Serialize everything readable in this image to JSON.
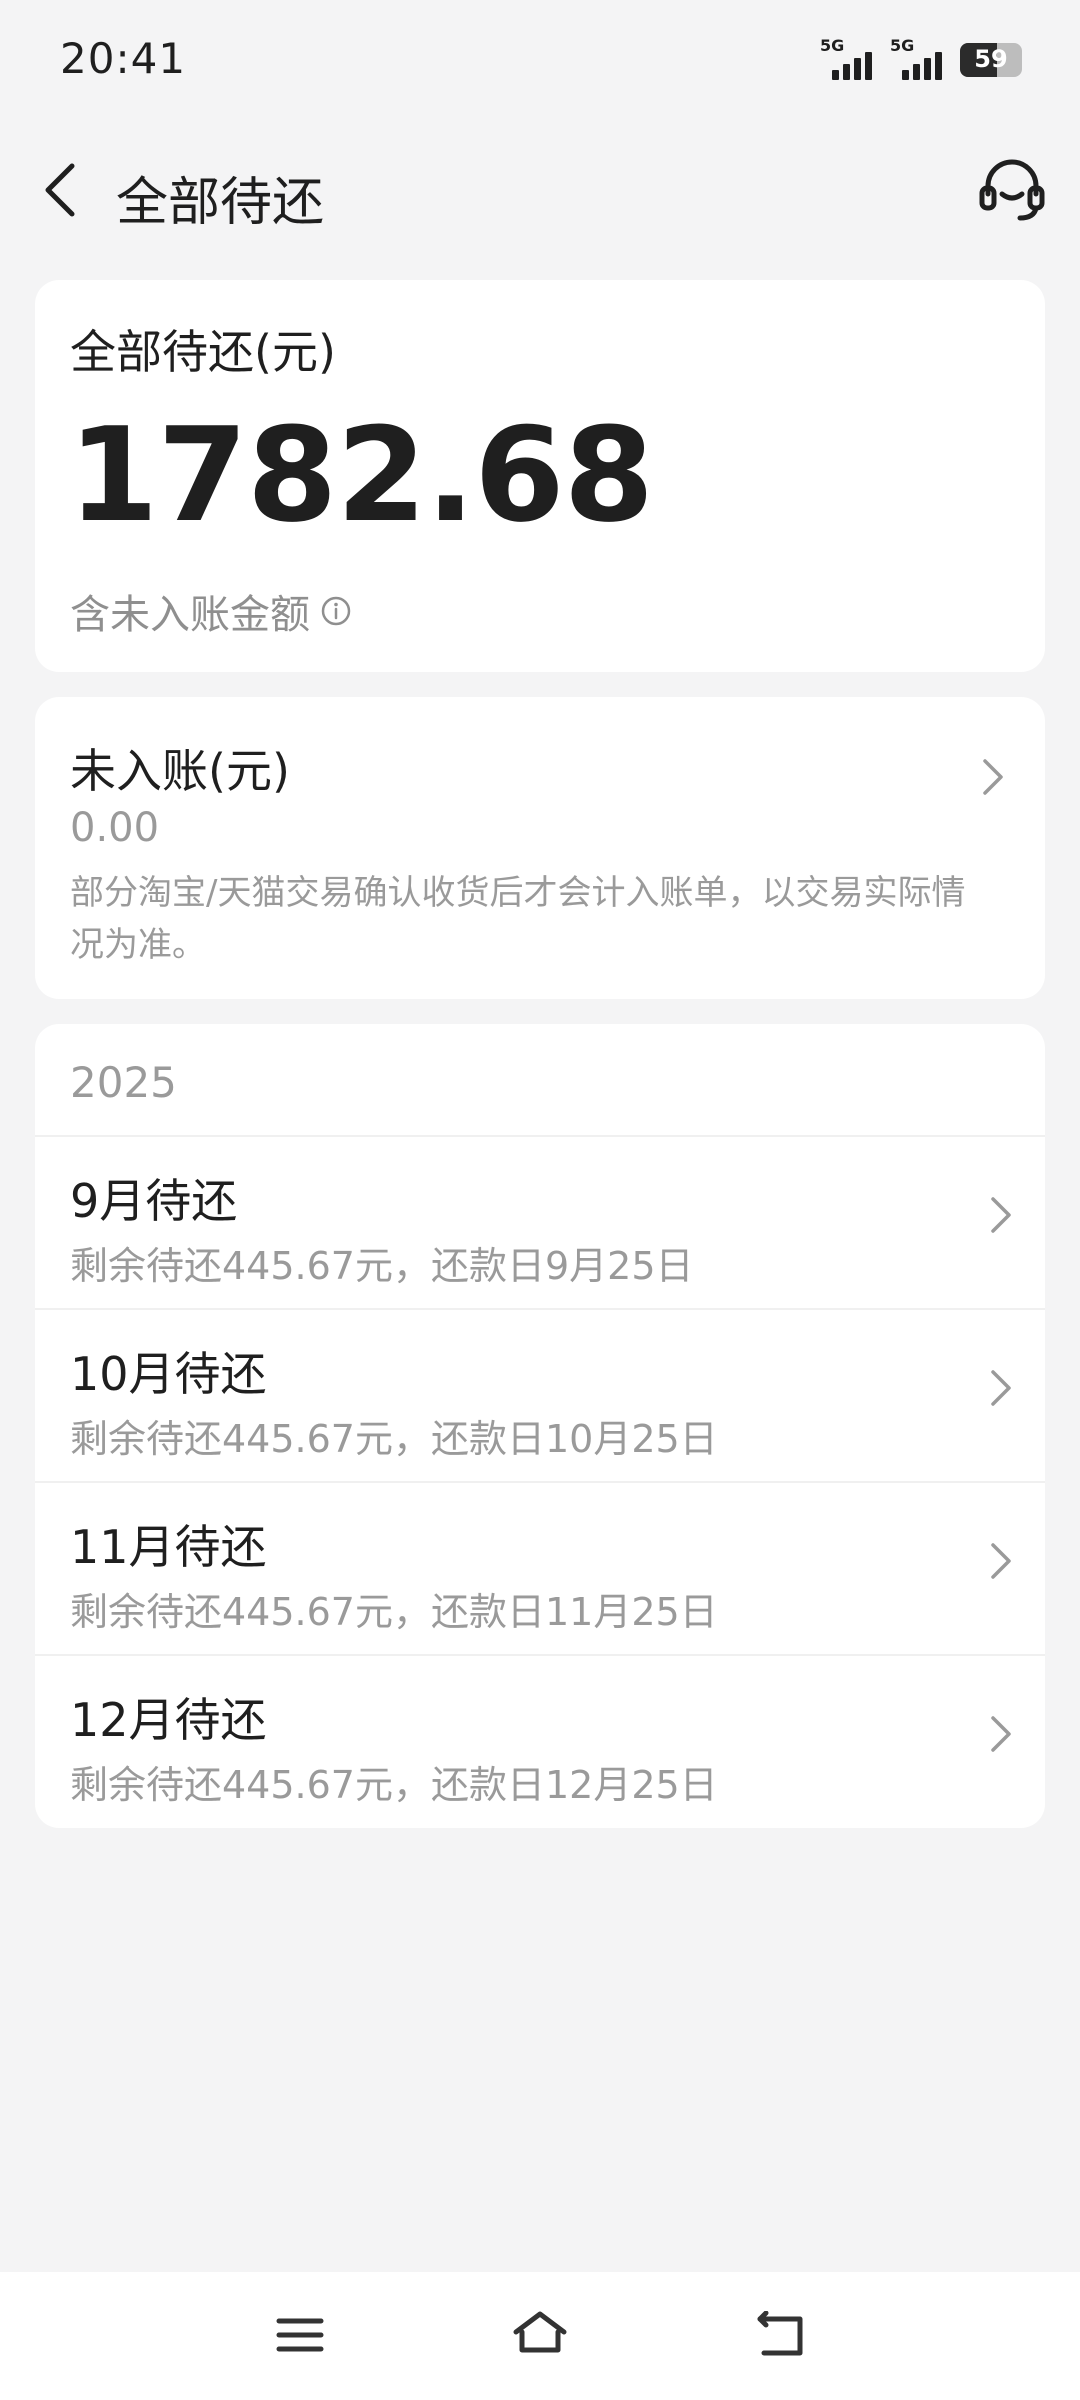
{
  "status": {
    "time": "20:41",
    "signal1": "5G",
    "signal2": "5G",
    "battery": "59",
    "battery_level_percent": 59
  },
  "nav": {
    "title": "全部待还",
    "back_icon": "chevron-left-icon",
    "service_icon": "headset-icon"
  },
  "total": {
    "label": "全部待还(元)",
    "amount": "1782.68",
    "note": "含未入账金额"
  },
  "unposted": {
    "label": "未入账(元)",
    "amount": "0.00",
    "description": "部分淘宝/天猫交易确认收货后才会计入账单，以交易实际情况为准。"
  },
  "bills": {
    "year": "2025",
    "items": [
      {
        "title": "9月待还",
        "subtitle": "剩余待还445.67元，还款日9月25日"
      },
      {
        "title": "10月待还",
        "subtitle": "剩余待还445.67元，还款日10月25日"
      },
      {
        "title": "11月待还",
        "subtitle": "剩余待还445.67元，还款日11月25日"
      },
      {
        "title": "12月待还",
        "subtitle": "剩余待还445.67元，还款日12月25日"
      }
    ]
  },
  "colors": {
    "background": "#f4f4f5",
    "card": "#ffffff",
    "text_primary": "#1f1f1f",
    "text_secondary": "#9a9a9a"
  }
}
